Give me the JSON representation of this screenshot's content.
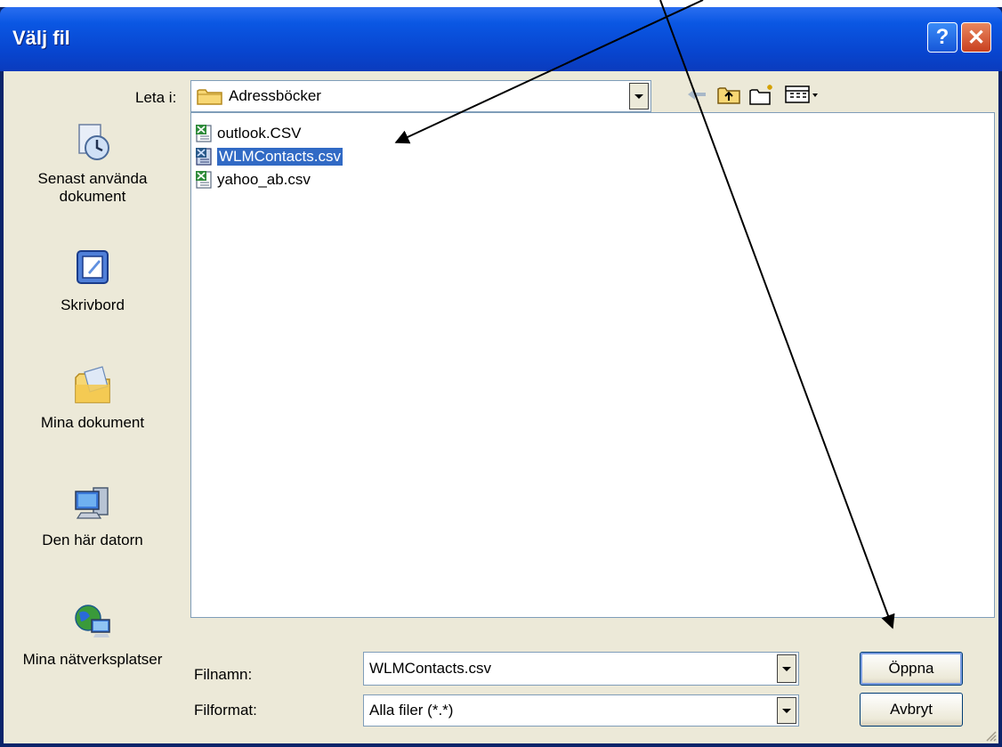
{
  "window": {
    "title": "Välj fil"
  },
  "titlebar_buttons": {
    "help": "?",
    "close": "✕"
  },
  "lookin": {
    "label": "Leta i:",
    "value": "Adressböcker"
  },
  "toolbar": {
    "icons": [
      "back-arrow-icon",
      "up-folder-icon",
      "new-folder-icon",
      "view-menu-icon"
    ]
  },
  "places": [
    {
      "label": "Senast använda dokument",
      "icon": "recent-documents-icon"
    },
    {
      "label": "Skrivbord",
      "icon": "desktop-icon"
    },
    {
      "label": "Mina dokument",
      "icon": "my-documents-icon"
    },
    {
      "label": "Den här datorn",
      "icon": "my-computer-icon"
    },
    {
      "label": "Mina nätverksplatser",
      "icon": "network-places-icon"
    }
  ],
  "files": [
    {
      "name": "outlook.CSV",
      "selected": false
    },
    {
      "name": "WLMContacts.csv",
      "selected": true
    },
    {
      "name": "yahoo_ab.csv",
      "selected": false
    }
  ],
  "filename": {
    "label": "Filnamn:",
    "value": "WLMContacts.csv"
  },
  "filetype": {
    "label": "Filformat:",
    "value": "Alla filer (*.*)"
  },
  "buttons": {
    "open": "Öppna",
    "cancel": "Avbryt"
  },
  "colors": {
    "title_bar": "#0a57e3",
    "selection": "#316ac5",
    "dialog_bg": "#ece9d8"
  }
}
